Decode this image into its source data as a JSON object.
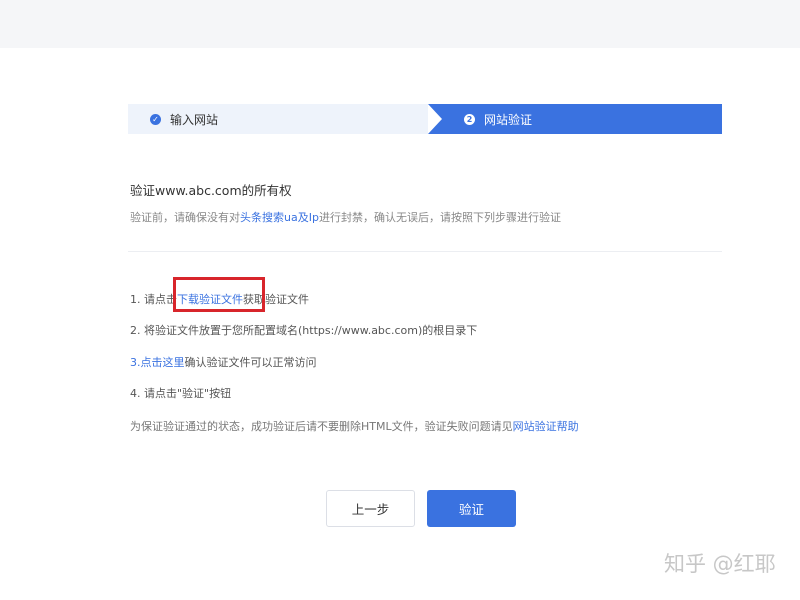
{
  "steps": [
    {
      "icon": "✓",
      "label": "输入网站"
    },
    {
      "icon": "2",
      "label": "网站验证"
    }
  ],
  "content": {
    "title": "验证www.abc.com的所有权",
    "desc_prefix": "验证前，请确保没有对",
    "desc_link": "头条搜索ua及Ip",
    "desc_suffix": "进行封禁，确认无误后，请按照下列步骤进行验证"
  },
  "instructions": {
    "line1_prefix": "1. 请点击",
    "line1_link": "下载验证文件",
    "line1_suffix": "获取验证文件",
    "line2": "2. 将验证文件放置于您所配置域名(https://www.abc.com)的根目录下",
    "line3_link": "3.点击这里",
    "line3_suffix": "确认验证文件可以正常访问",
    "line4": "4. 请点击\"验证\"按钮",
    "line5_prefix": "为保证验证通过的状态，成功验证后请不要删除HTML文件，验证失败问题请见",
    "line5_link": "网站验证帮助"
  },
  "buttons": {
    "prev": "上一步",
    "verify": "验证"
  },
  "watermark": "知乎 @红耶",
  "colors": {
    "primary": "#3a72e0",
    "highlight": "#d8252b"
  }
}
